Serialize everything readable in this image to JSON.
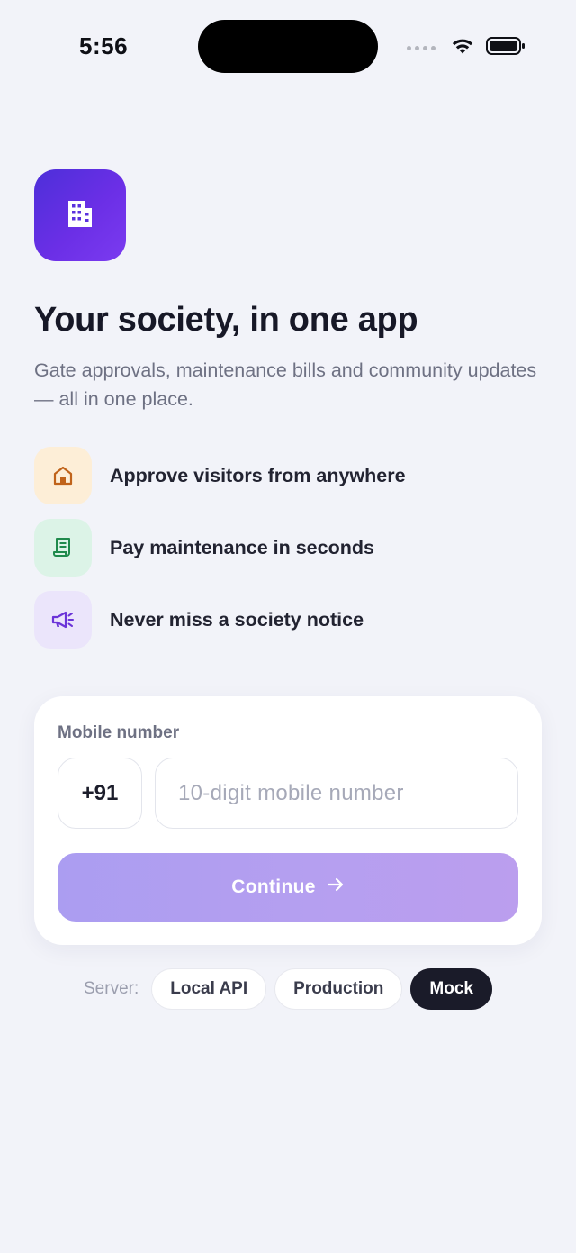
{
  "status_bar": {
    "time": "5:56"
  },
  "hero": {
    "title": "Your society, in one app",
    "subtitle": "Gate approvals, maintenance bills and community updates — all in one place."
  },
  "features": [
    {
      "icon": "home-icon",
      "label": "Approve visitors from anywhere",
      "bg": "#fdeed7",
      "color": "#c0631a"
    },
    {
      "icon": "receipt-icon",
      "label": "Pay maintenance in seconds",
      "bg": "#dcf3e7",
      "color": "#1f8a4c"
    },
    {
      "icon": "megaphone-icon",
      "label": "Never miss a society notice",
      "bg": "#ebe5fb",
      "color": "#6b34d8"
    }
  ],
  "login": {
    "field_label": "Mobile number",
    "country_code": "+91",
    "phone_placeholder": "10-digit mobile number",
    "phone_value": "",
    "continue_label": "Continue"
  },
  "server": {
    "label": "Server:",
    "options": [
      "Local API",
      "Production",
      "Mock"
    ],
    "selected": "Mock"
  },
  "colors": {
    "accent": "#6b2fe6",
    "background": "#f2f3f9",
    "dark": "#1a1b29"
  }
}
